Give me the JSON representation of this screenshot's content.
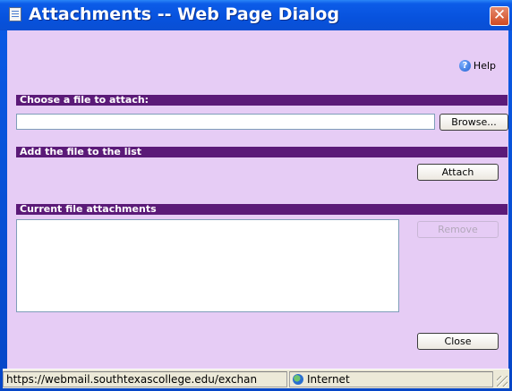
{
  "window": {
    "title": "Attachments -- Web Page Dialog",
    "close_glyph": "✕"
  },
  "help": {
    "label": "Help",
    "icon_glyph": "?"
  },
  "sections": {
    "choose_file": "Choose a file to attach:",
    "add_file": "Add the file to the list",
    "current_attachments": "Current file attachments"
  },
  "buttons": {
    "browse": "Browse...",
    "attach": "Attach",
    "remove": "Remove",
    "close": "Close"
  },
  "file_input": {
    "value": ""
  },
  "attachments": [],
  "statusbar": {
    "url": "https://webmail.southtexascollege.edu/exchan",
    "zone": "Internet"
  },
  "colors": {
    "client_bg": "#e6ccf5",
    "section_bar": "#5b1a78",
    "titlebar": "#0752dd"
  }
}
